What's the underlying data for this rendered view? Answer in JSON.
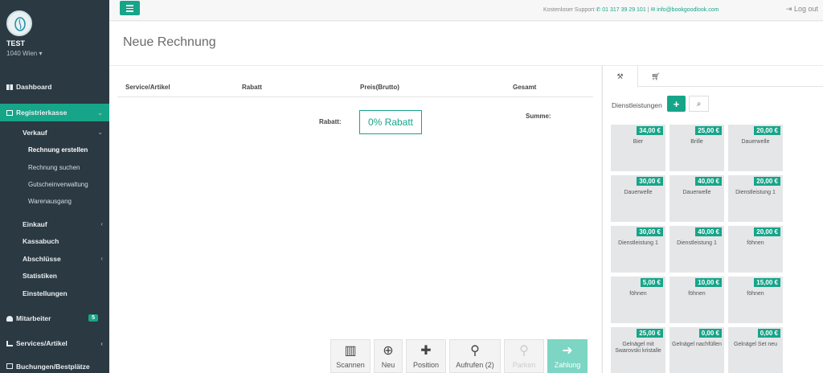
{
  "user": {
    "name": "TEST",
    "location": "1040 Wien ▾"
  },
  "sidebar": {
    "dashboard": "Dashboard",
    "registrierkasse": "Registrierkasse",
    "verkauf": "Verkauf",
    "verkauf_items": [
      "Rechnung erstellen",
      "Rechnung suchen",
      "Gutscheinverwaltung",
      "Warenausgang"
    ],
    "einkauf": "Einkauf",
    "kassabuch": "Kassabuch",
    "abschluesse": "Abschlüsse",
    "statistiken": "Statistiken",
    "einstellungen": "Einstellungen",
    "mitarbeiter": "Mitarbeiter",
    "mitarbeiter_badge": "5",
    "services": "Services/Artikel",
    "buchungen": "Buchungen/Bestplätze"
  },
  "topbar": {
    "support_label": "Kostenloser Support",
    "phone": "01 317 39 29 101",
    "separator": "|",
    "email": "info@bookgoodlook.com",
    "logout": "Log out"
  },
  "page": {
    "title": "Neue Rechnung"
  },
  "table": {
    "headers": [
      "Service/Artikel",
      "Rabatt",
      "Preis(Brutto)",
      "Gesamt"
    ],
    "rabatt_label": "Rabatt:",
    "rabatt_button": "0% Rabatt",
    "summe_label": "Summe:"
  },
  "actions": {
    "scannen": "Scannen",
    "neu": "Neu",
    "position": "Position",
    "aufrufen": "Aufrufen (2)",
    "parken": "Parken",
    "zahlung": "Zahlung"
  },
  "panel": {
    "label": "Dienstleistungen",
    "add": "+",
    "items": [
      {
        "price": "34,00 €",
        "name": "Bier"
      },
      {
        "price": "25,00 €",
        "name": "Brille"
      },
      {
        "price": "20,00 €",
        "name": "Dauerwelle"
      },
      {
        "price": "30,00 €",
        "name": "Dauerwelle"
      },
      {
        "price": "40,00 €",
        "name": "Dauerwelle"
      },
      {
        "price": "20,00 €",
        "name": "Dienstleistung 1"
      },
      {
        "price": "30,00 €",
        "name": "Dienstleistung 1"
      },
      {
        "price": "40,00 €",
        "name": "Dienstleistung 1"
      },
      {
        "price": "20,00 €",
        "name": "föhnen"
      },
      {
        "price": "5,00 €",
        "name": "föhnen"
      },
      {
        "price": "10,00 €",
        "name": "föhnen"
      },
      {
        "price": "15,00 €",
        "name": "föhnen"
      },
      {
        "price": "25,00 €",
        "name": "Gelnägel mit Swarovski kristalle"
      },
      {
        "price": "0,00 €",
        "name": "Gelnägel nachfüllen"
      },
      {
        "price": "0,00 €",
        "name": "Gelnägel Set neu"
      }
    ]
  },
  "colors": {
    "accent": "#17a589",
    "sidebar": "#2b3942"
  }
}
